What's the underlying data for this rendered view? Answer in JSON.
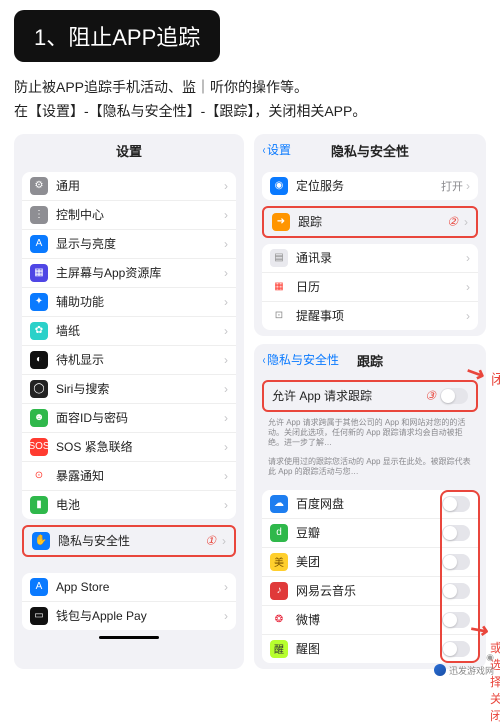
{
  "heading": "1、阻止APP追踪",
  "instructions_line1": "防止被APP追踪手机活动、监｜听你的操作等。",
  "instructions_line2": "在【设置】-【隐私与安全性】-【跟踪】，关闭相关APP。",
  "left": {
    "title": "设置",
    "g1": [
      {
        "label": "通用",
        "icon": "⚙",
        "bg": "#8e8e93"
      },
      {
        "label": "控制中心",
        "icon": "⋮",
        "bg": "#8e8e93"
      },
      {
        "label": "显示与亮度",
        "icon": "A",
        "bg": "#0a7aff"
      },
      {
        "label": "主屏幕与App资源库",
        "icon": "▦",
        "bg": "#4f46e5"
      },
      {
        "label": "辅助功能",
        "icon": "✦",
        "bg": "#0a7aff"
      },
      {
        "label": "墙纸",
        "icon": "✿",
        "bg": "#2ad1c9"
      },
      {
        "label": "待机显示",
        "icon": "◐",
        "bg": "#111"
      },
      {
        "label": "Siri与搜索",
        "icon": "◯",
        "bg": "#222"
      },
      {
        "label": "面容ID与密码",
        "icon": "☻",
        "bg": "#2fb84b"
      },
      {
        "label": "SOS 紧急联络",
        "icon": "SOS",
        "bg": "#ff3b30"
      },
      {
        "label": "暴露通知",
        "icon": "⊙",
        "bg": "#fff",
        "fg": "#ff3b30"
      },
      {
        "label": "电池",
        "icon": "▮",
        "bg": "#2fb84b"
      }
    ],
    "privacy": {
      "label": "隐私与安全性",
      "icon": "✋",
      "bg": "#0a7aff",
      "badge": "①"
    },
    "g2": [
      {
        "label": "App Store",
        "icon": "A",
        "bg": "#0a7aff"
      },
      {
        "label": "钱包与Apple Pay",
        "icon": "▭",
        "bg": "#111"
      }
    ]
  },
  "right1": {
    "back": "设置",
    "title": "隐私与安全性",
    "loc": {
      "label": "定位服务",
      "value": "打开",
      "icon": "◉",
      "bg": "#0a7aff"
    },
    "track": {
      "label": "跟踪",
      "icon": "➜",
      "bg": "#ff9500",
      "badge": "②"
    },
    "rows": [
      {
        "label": "通讯录",
        "icon": "▤",
        "bg": "#e9e9ee",
        "fg": "#888"
      },
      {
        "label": "日历",
        "icon": "▦",
        "bg": "#fff",
        "fg": "#ff3b30"
      },
      {
        "label": "提醒事项",
        "icon": "⊡",
        "bg": "#fff",
        "fg": "#888"
      }
    ]
  },
  "right2": {
    "back": "隐私与安全性",
    "title": "跟踪",
    "allow": {
      "label": "允许 App 请求跟踪",
      "badge": "③"
    },
    "desc1": "允许 App 请求跨属于其他公司的 App 和网站对您的的活动。关闭此选项，任何新的 App 跟踪请求均会自动被拒绝。进一步了解…",
    "desc2": "请求使用过的跟踪您活动的 App 显示在此处。被跟踪代表此 App 的跟踪活动与您…",
    "apps": [
      {
        "label": "百度网盘",
        "icon": "☁",
        "bg": "#1e7ef0"
      },
      {
        "label": "豆瓣",
        "icon": "d",
        "bg": "#2fb84b"
      },
      {
        "label": "美团",
        "icon": "美",
        "bg": "#ffcf2d",
        "fg": "#7a5200"
      },
      {
        "label": "网易云音乐",
        "icon": "♪",
        "bg": "#e03a3a"
      },
      {
        "label": "微博",
        "icon": "❂",
        "bg": "#fff",
        "fg": "#e6162d"
      },
      {
        "label": "醒图",
        "icon": "醒",
        "bg": "#b7ff2e",
        "fg": "#333"
      }
    ]
  },
  "callouts": {
    "direct": "直接关闭",
    "or": "或选择关闭"
  },
  "watermark": "迅发游戏网"
}
